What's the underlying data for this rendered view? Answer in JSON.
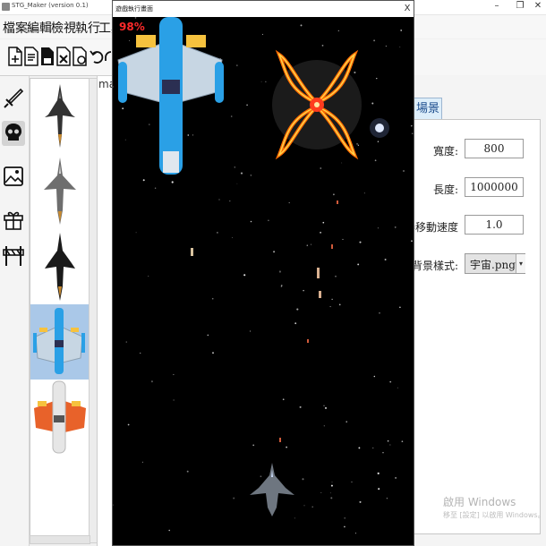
{
  "app": {
    "title": "STG_Maker (version 0.1)"
  },
  "window_controls": {
    "minimize": "–",
    "maximize": "❐",
    "close": "✕"
  },
  "menu": [
    "檔案",
    "編輯",
    "檢視",
    "執行",
    "工具"
  ],
  "toolbar": [
    "new-file-icon",
    "open-file-icon",
    "save-file-icon",
    "delete-file-icon",
    "file-settings-icon",
    "undo-icon",
    "redo-icon"
  ],
  "category_bar": [
    "sword-icon",
    "skull-icon",
    "image-icon",
    "gift-icon",
    "barrier-icon"
  ],
  "sprites": [
    "dark-jet-1",
    "grey-jet",
    "black-jet",
    "blue-ship",
    "orange-ship"
  ],
  "canvas": {
    "tab_label": "ma"
  },
  "properties": {
    "tab": "場景",
    "fields": [
      {
        "label": "寬度:",
        "value": "800"
      },
      {
        "label": "長度:",
        "value": "1000000"
      },
      {
        "label": "捲移動速度:",
        "value": "1.0"
      }
    ],
    "bg_style": {
      "label": "背景樣式:",
      "value": "宇宙.png"
    }
  },
  "game_window": {
    "title": "遊戲執行畫面",
    "close": "X",
    "fps": "98%"
  },
  "watermark": {
    "line1": "啟用 Windows",
    "line2": "移至 [設定] 以啟用 Windows。"
  },
  "colors": {
    "selection": "#aac8e8",
    "accent": "#1a4b8c",
    "fps": "#ff2a2a",
    "space": "#000000"
  }
}
